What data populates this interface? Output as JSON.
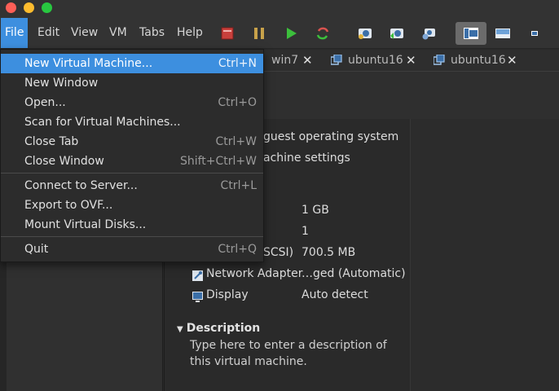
{
  "menubar": {
    "items": [
      "File",
      "Edit",
      "View",
      "VM",
      "Tabs",
      "Help"
    ],
    "active": "File"
  },
  "toolbar": {
    "icons": [
      "stop-icon",
      "pause-icon",
      "play-icon",
      "restart-icon",
      "snapshot-icon",
      "revert-snapshot-icon",
      "manage-snapshots-icon",
      "console-view-icon",
      "fullscreen-icon",
      "unity-icon"
    ],
    "colors": {
      "stop": "#d9534f",
      "pause": "#c8a24a",
      "play": "#3cbf3c",
      "restart": "#d9534f"
    }
  },
  "tabs": [
    {
      "label": "win7"
    },
    {
      "label": "ubuntu16"
    },
    {
      "label": "ubuntu16"
    }
  ],
  "file_menu": {
    "groups": [
      [
        {
          "label": "New Virtual Machine...",
          "shortcut": "Ctrl+N",
          "highlighted": true
        },
        {
          "label": "New Window",
          "shortcut": ""
        },
        {
          "label": "Open...",
          "shortcut": "Ctrl+O"
        },
        {
          "label": "Scan for Virtual Machines...",
          "shortcut": ""
        },
        {
          "label": "Close Tab",
          "shortcut": "Ctrl+W"
        },
        {
          "label": "Close Window",
          "shortcut": "Shift+Ctrl+W"
        }
      ],
      [
        {
          "label": "Connect to Server...",
          "shortcut": "Ctrl+L"
        },
        {
          "label": "Export to OVF...",
          "shortcut": ""
        },
        {
          "label": "Mount Virtual Disks...",
          "shortcut": ""
        }
      ],
      [
        {
          "label": "Quit",
          "shortcut": "Ctrl+Q"
        }
      ]
    ]
  },
  "vm_panel": {
    "commands": [
      "guest operating system",
      "achine settings"
    ],
    "devices": [
      {
        "name": "",
        "value": "1 GB"
      },
      {
        "name": "",
        "value": "1"
      },
      {
        "name": "SCSI)",
        "value": "700.5 MB"
      },
      {
        "name": "Network Adapter",
        "value": "…ged (Automatic)",
        "icon": "network-adapter-icon"
      },
      {
        "name": "Display",
        "value": "Auto detect",
        "icon": "display-icon"
      }
    ],
    "description": {
      "heading": "Description",
      "placeholder": "Type here to enter a description of this virtual machine."
    }
  },
  "colors": {
    "accent": "#3d8fdf",
    "background": "#2a2a2a"
  }
}
